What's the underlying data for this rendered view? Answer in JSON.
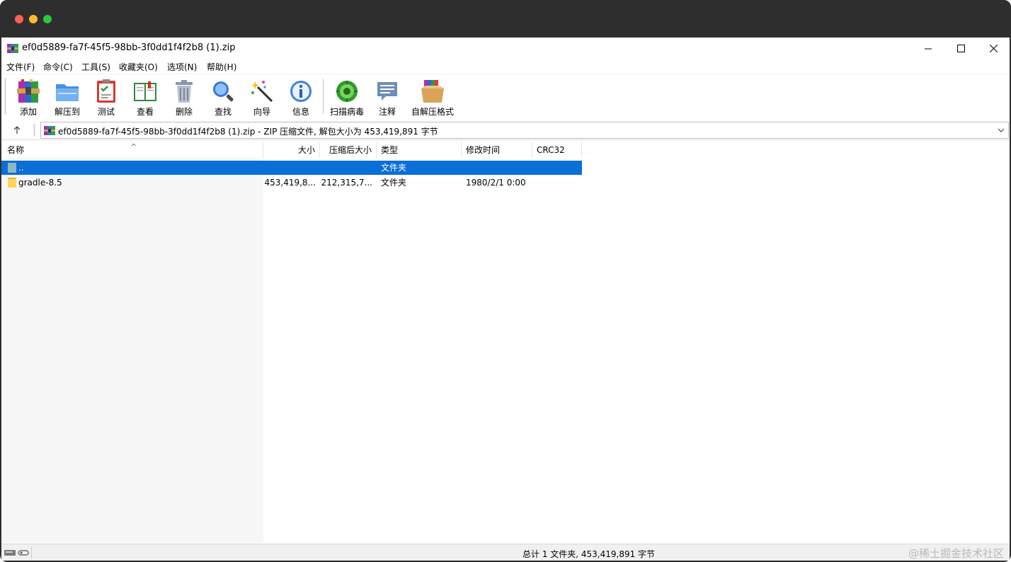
{
  "window": {
    "title": "ef0d5889-fa7f-45f5-98bb-3f0dd1f4f2b8 (1).zip"
  },
  "menu": [
    {
      "label": "文件(F)"
    },
    {
      "label": "命令(C)"
    },
    {
      "label": "工具(S)"
    },
    {
      "label": "收藏夹(O)"
    },
    {
      "label": "选项(N)"
    },
    {
      "label": "帮助(H)"
    }
  ],
  "toolbar": [
    {
      "label": "添加",
      "icon": "add-archive-icon"
    },
    {
      "label": "解压到",
      "icon": "extract-to-icon"
    },
    {
      "label": "测试",
      "icon": "test-icon"
    },
    {
      "label": "查看",
      "icon": "view-book-icon"
    },
    {
      "label": "删除",
      "icon": "trash-icon"
    },
    {
      "label": "查找",
      "icon": "magnifier-icon"
    },
    {
      "label": "向导",
      "icon": "wizard-wand-icon"
    },
    {
      "label": "信息",
      "icon": "info-icon"
    },
    {
      "label": "扫描病毒",
      "icon": "virus-scan-icon"
    },
    {
      "label": "注释",
      "icon": "comment-icon"
    },
    {
      "label": "自解压格式",
      "icon": "sfx-box-icon"
    }
  ],
  "address": {
    "text": "ef0d5889-fa7f-45f5-98bb-3f0dd1f4f2b8 (1).zip - ZIP 压缩文件, 解包大小为 453,419,891 字节"
  },
  "columns": {
    "name": "名称",
    "size": "大小",
    "packed": "压缩后大小",
    "type": "类型",
    "modified": "修改时间",
    "crc": "CRC32"
  },
  "rows": [
    {
      "name": "..",
      "size": "",
      "packed": "",
      "type": "文件夹",
      "modified": "",
      "crc": ""
    },
    {
      "name": "gradle-8.5",
      "size": "453,419,8...",
      "packed": "212,315,7...",
      "type": "文件夹",
      "modified": "1980/2/1 0:00",
      "crc": ""
    }
  ],
  "status": {
    "summary": "总计 1 文件夹, 453,419,891 字节",
    "watermark": "@稀土掘金技术社区"
  },
  "colors": {
    "selection": "#0a6fd6",
    "folder": "#ffd65a",
    "mac_chrome": "#2e2e2e"
  }
}
